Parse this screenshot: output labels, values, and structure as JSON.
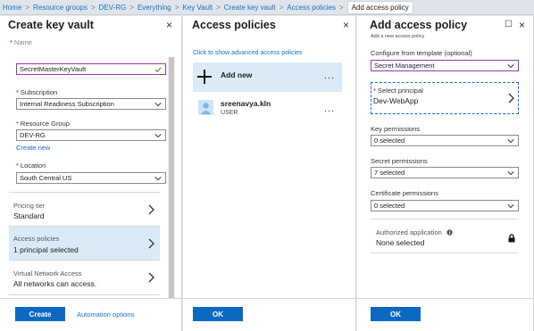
{
  "breadcrumb": {
    "items": [
      "Home",
      "Resource groups",
      "DEV-RG",
      "Everything",
      "Key Vault",
      "Create key vault",
      "Access policies",
      "Add access policy"
    ],
    "separator": ">"
  },
  "blade1": {
    "title": "Create key vault",
    "close": "×",
    "name_label": "Name",
    "name_value": "SecretMasterKeyVault",
    "subscription_label": "Subscription",
    "subscription_value": "Internal Readiness Subscription",
    "resource_group_label": "Resource Group",
    "resource_group_value": "DEV-RG",
    "create_new": "Create new",
    "location_label": "Location",
    "location_value": "South Central US",
    "req_star": "*",
    "pricing_title": "Pricing tier",
    "pricing_value": "Standard",
    "access_title": "Access policies",
    "access_value": "1 principal selected",
    "vnet_title": "Virtual Network Access",
    "vnet_value": "All networks can access.",
    "create_button": "Create",
    "automation_link": "Automation options"
  },
  "blade2": {
    "title": "Access policies",
    "close": "×",
    "advanced_link": "Click to show advanced access policies",
    "add_new": "Add new",
    "user_name": "sreenavya.kln",
    "user_role": "USER",
    "more": "...",
    "ok_button": "OK"
  },
  "blade3": {
    "title": "Add access policy",
    "subtitle": "Add a new access policy",
    "maximize": "☐",
    "close": "×",
    "template_label": "Configure from template (optional)",
    "template_value": "Secret Management",
    "principal_label": "Select principal",
    "principal_value": "Dev-WebApp",
    "key_label": "Key permissions",
    "key_value": "0 selected",
    "secret_label": "Secret permissions",
    "secret_value": "7 selected",
    "cert_label": "Certificate permissions",
    "cert_value": "0 selected",
    "auth_label": "Authorized application",
    "auth_value": "None selected",
    "ok_button": "OK"
  },
  "colors": {
    "accent": "#0c69c2",
    "link": "#1b6fc4",
    "selected_bg": "#dbeaf7",
    "focus_border": "#9b36b8"
  }
}
